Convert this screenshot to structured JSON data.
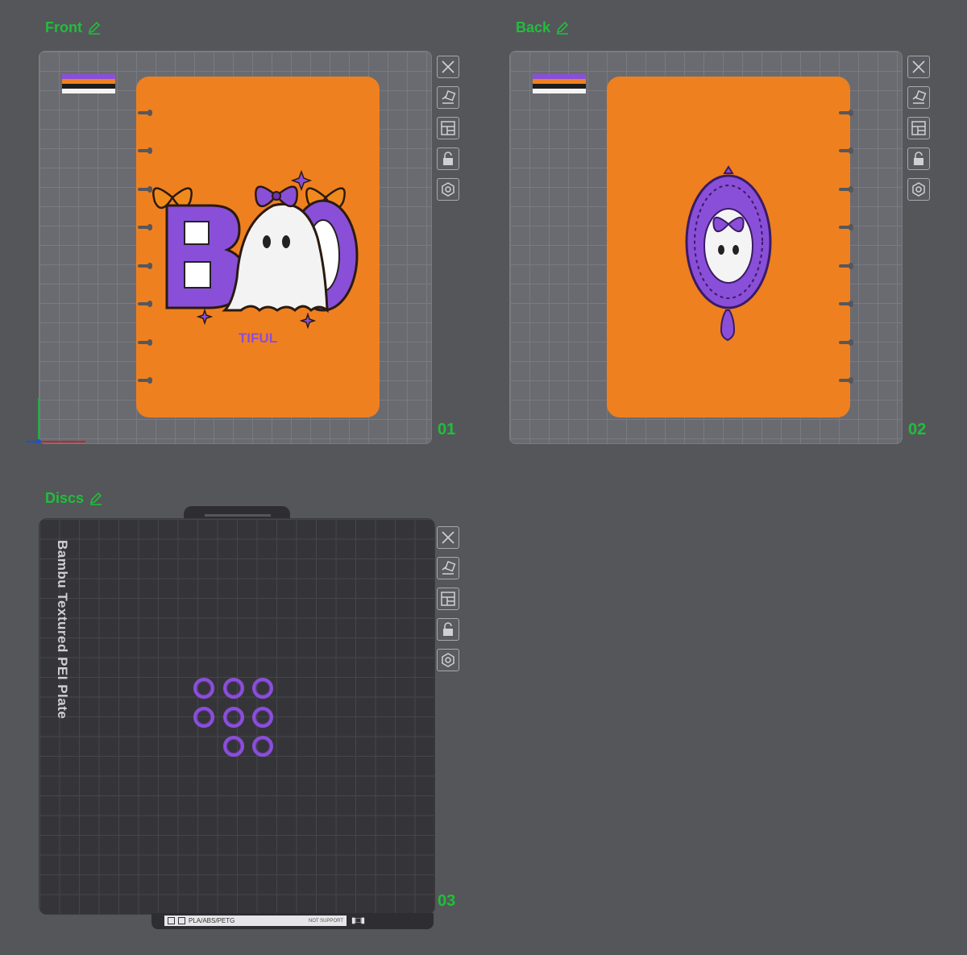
{
  "plates": [
    {
      "title": "Front",
      "number": "01"
    },
    {
      "title": "Back",
      "number": "02"
    },
    {
      "title": "Discs",
      "number": "03"
    }
  ],
  "front_art": {
    "word": "B O",
    "sub": "TIFUL"
  },
  "bed3": {
    "plate_name": "Bambu Textured PEI Plate",
    "footer_label": "PLA/ABS/PETG",
    "footer_note": "NOT SUPPORT"
  },
  "colors": {
    "accent": "#1fbf3a",
    "cover": "#ef801f",
    "purple": "#8a4fd8"
  },
  "toolbar_icons": [
    "close-icon",
    "auto-orient-icon",
    "arrange-icon",
    "lock-icon",
    "settings-icon"
  ]
}
